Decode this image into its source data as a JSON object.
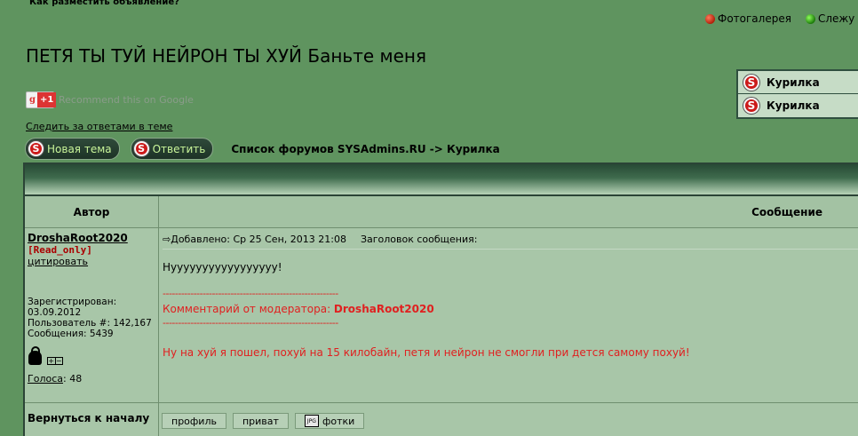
{
  "header": {
    "howto_link": "Как разместить объявление?",
    "top_links": [
      {
        "icon": "red-dot-icon",
        "label": "Фотогалерея"
      },
      {
        "icon": "green-dot-icon",
        "label": "Слежу за"
      }
    ],
    "topic_title": "ПЕТЯ ТЫ ТУЙ НЕЙРОН ТЫ ХУЙ Баньте меня"
  },
  "side_box": {
    "items": [
      {
        "label": "Курилка"
      },
      {
        "label": "Курилка"
      }
    ]
  },
  "gplus": {
    "g": "g",
    "plus": "+1",
    "text": "Recommend this on Google"
  },
  "follow_link": "Следить за ответами в теме",
  "buttons": {
    "new_topic": "Новая тема",
    "reply": "Ответить"
  },
  "breadcrumb": "Список форумов SYSAdmins.RU -> Курилка",
  "table": {
    "col_author": "Автор",
    "col_message": "Сообщение"
  },
  "post": {
    "author": "DroshaRoot2020",
    "status": "[Read_only]",
    "quote": "цитировать",
    "registered_label": "Зарегистрирован:",
    "registered_date": "03.09.2012",
    "user_number": "Пользователь #: 142,167",
    "posts": "Сообщения: 5439",
    "votes_label": "Голоса",
    "votes_value": ": 48",
    "added": "Добавлено: Ср 25 Сен, 2013 21:08",
    "subject_label": "Заголовок сообщения:",
    "body": "Нууууууууууууууууу!",
    "mod_dashes": "---------------------------------------------------------",
    "mod_comment_label": "Комментарий от модератора: ",
    "mod_comment_name": "DroshaRoot2020",
    "mod_text": "Ну на хуй я пошел, похуй на 15 килобайн, петя и нейрон не смогли при дется самому похуй!"
  },
  "footer": {
    "back_to_top": "Вернуться к началу",
    "profile": "профиль",
    "private": "приват",
    "photos": "фотки",
    "jpg_label": "JPG"
  },
  "colors": {
    "background": "#5f945f",
    "moderator_red": "#e02020",
    "button_text": "#c9f59a"
  }
}
